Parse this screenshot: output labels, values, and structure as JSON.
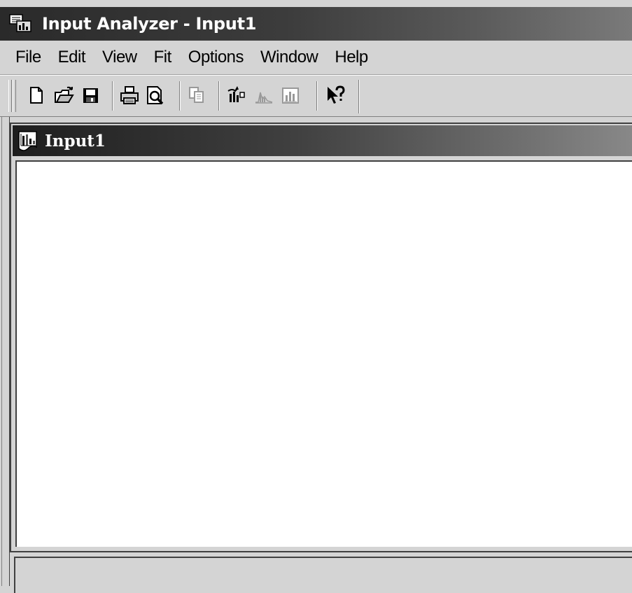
{
  "window": {
    "title": "Input Analyzer - Input1"
  },
  "menubar": {
    "items": [
      {
        "label": "File"
      },
      {
        "label": "Edit"
      },
      {
        "label": "View"
      },
      {
        "label": "Fit"
      },
      {
        "label": "Options"
      },
      {
        "label": "Window"
      },
      {
        "label": "Help"
      }
    ]
  },
  "toolbar": {
    "buttons": [
      {
        "icon": "new-document-icon",
        "enabled": true
      },
      {
        "icon": "open-folder-icon",
        "enabled": true
      },
      {
        "icon": "save-disk-icon",
        "enabled": true
      },
      {
        "icon": "print-icon",
        "enabled": true
      },
      {
        "icon": "print-preview-icon",
        "enabled": true
      },
      {
        "icon": "copy-icon",
        "enabled": false
      },
      {
        "icon": "fit-data-icon",
        "enabled": true
      },
      {
        "icon": "distribution-icon",
        "enabled": false
      },
      {
        "icon": "histogram-icon",
        "enabled": false
      },
      {
        "icon": "context-help-icon",
        "enabled": true
      }
    ]
  },
  "document": {
    "title": "Input1"
  }
}
